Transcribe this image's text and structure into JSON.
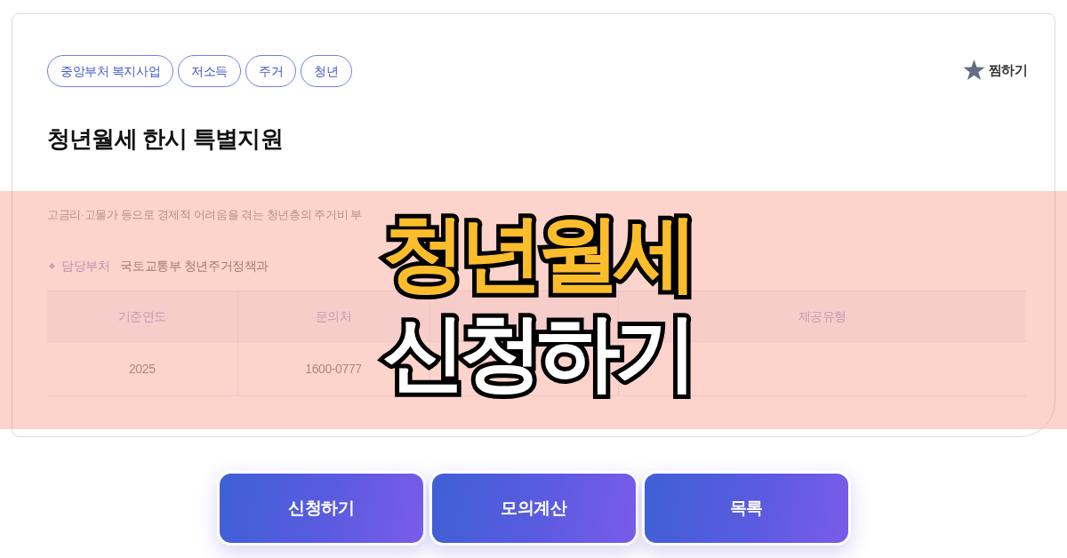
{
  "card": {
    "tags": [
      "중앙부처 복지사업",
      "저소득",
      "주거",
      "청년"
    ],
    "bookmark": {
      "label": "찜하기"
    },
    "title": "청년월세 한시 특별지원",
    "description": "고금리·고물가 등으로 경제적 어려움을 겪는 청년층의 주거비 부",
    "department": {
      "label": "담당부처",
      "value": "국토교통부 청년주거정책과"
    },
    "table": {
      "columns": [
        "기준연도",
        "문의처",
        null,
        "제공유형"
      ],
      "rows": [
        [
          "2025",
          "1600-0777",
          null,
          null
        ]
      ]
    }
  },
  "banner": {
    "lines": [
      {
        "text": "청년월세",
        "color": "#fbbd2c"
      },
      {
        "text": "신청하기",
        "color": "#ffffff"
      }
    ]
  },
  "actions": [
    {
      "label": "신청하기"
    },
    {
      "label": "모의계산"
    },
    {
      "label": "목록"
    }
  ]
}
